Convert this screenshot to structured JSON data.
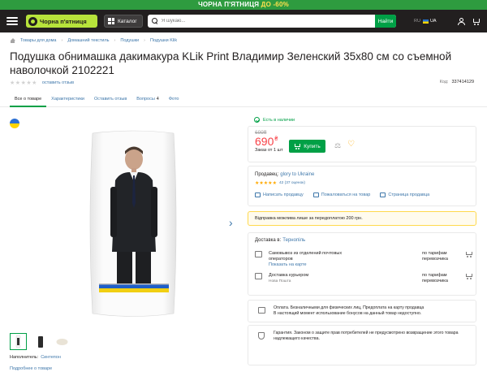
{
  "promo": {
    "text": "ЧОРНА П'ЯТНИЦЯ",
    "discount_prefix": "ДО",
    "discount": "-60%"
  },
  "header": {
    "logo_text": "Чорна п'ятниця",
    "catalog_label": "Каталог",
    "search_placeholder": "Я шукаю...",
    "search_button": "Найти",
    "lang_ru": "RU",
    "lang_ua": "UA"
  },
  "breadcrumbs": [
    "Товары для дома",
    "Домашний текстиль",
    "Подушки",
    "Подушки Klik"
  ],
  "product": {
    "title": "Подушка обнимашка дакимакура KLik Print Владимир Зеленский 35х80 см со съемной наволочкой 2102221",
    "review_link": "оставить отзыв",
    "code_label": "Код:",
    "code": "337414129",
    "rating_stars": 0
  },
  "tabs": [
    {
      "label": "Все о товаре"
    },
    {
      "label": "Характеристики"
    },
    {
      "label": "Оставить отзыв"
    },
    {
      "label": "Вопросы",
      "count": "4"
    },
    {
      "label": "Фото"
    }
  ],
  "purchase": {
    "status": "Есть в наличии",
    "old_price": "699₴",
    "price": "690",
    "currency": "₴",
    "min_order": "Заказ от 1 шт",
    "buy_label": "Купить"
  },
  "seller": {
    "label": "Продавец:",
    "name": "glory to Ukraine",
    "rating": 4.5,
    "reviews": "42 (37 оценок)",
    "links": [
      "Написать продавцу",
      "Пожаловаться на товар",
      "Страница продавца"
    ]
  },
  "notice": "Відправка можлива лише за передоплатою 200 грн.",
  "delivery": {
    "label": "Доставка в:",
    "city": "Тернопіль",
    "options": [
      {
        "name": "Самовывоз из отделений почтовых операторов",
        "link": "Показать на карте",
        "price": "по тарифам перевозчика"
      },
      {
        "name": "Доставка курьером",
        "sub": "Нова Пошта",
        "price": "по тарифам перевозчика"
      }
    ]
  },
  "info": {
    "payment": "Оплата. Безналичными для физических лиц, Предоплата на карту продавца",
    "payment_note": "В настоящий момент использование бонусов на данный товар недоступно.",
    "warranty": "Гарантия. Законом о защите прав потребителей не предусмотрено возвращение этого товара надлежащего качества."
  },
  "gallery": {
    "next_arrow": "›"
  },
  "filler": {
    "label": "Наполнитель:",
    "value": "Синтепон"
  },
  "more_link": "Подробнее о товаре",
  "colors": {
    "accent": "#00a046",
    "price": "#f84147",
    "link": "#3e77aa",
    "promo": "#2e9b3f",
    "dark": "#221f1f"
  }
}
